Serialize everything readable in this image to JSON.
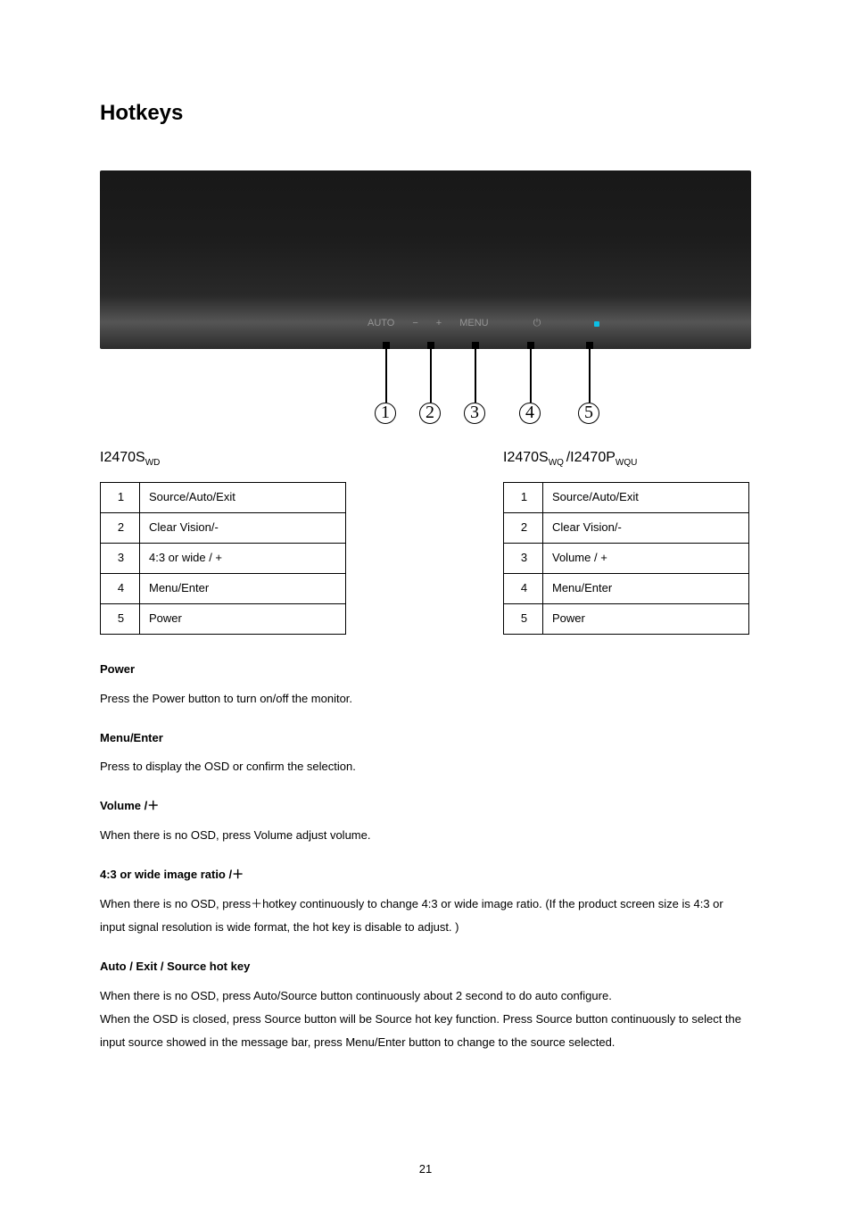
{
  "title": "Hotkeys",
  "hero": {
    "labels": {
      "auto": "AUTO",
      "minus": "−",
      "plus": "+",
      "menu": "MENU"
    },
    "power_icon": "⏻"
  },
  "pointers": [
    "1",
    "2",
    "3",
    "4",
    "5"
  ],
  "model_left": {
    "name": "I2470S",
    "suffix": "WD",
    "rows": [
      {
        "n": "1",
        "label": "Source/Auto/Exit"
      },
      {
        "n": "2",
        "label": "Clear Vision/-"
      },
      {
        "n": "3",
        "label": "4:3 or wide / +"
      },
      {
        "n": "4",
        "label": "Menu/Enter"
      },
      {
        "n": "5",
        "label": "Power"
      }
    ]
  },
  "model_right": {
    "name": "I2470S",
    "suffix": "WQ ",
    "sep": "/",
    "name2": "I2470P",
    "suffix2": "WQU",
    "rows": [
      {
        "n": "1",
        "label": "Source/Auto/Exit"
      },
      {
        "n": "2",
        "label": "Clear Vision/-"
      },
      {
        "n": "3",
        "label": "Volume / +"
      },
      {
        "n": "4",
        "label": "Menu/Enter"
      },
      {
        "n": "5",
        "label": "Power"
      }
    ]
  },
  "sections": {
    "power": {
      "title": "Power",
      "body": "Press the Power button to turn on/off the monitor."
    },
    "menu": {
      "title": "Menu/Enter",
      "body": "Press to display the OSD or confirm the selection."
    },
    "volume": {
      "title": "Volume /＋",
      "body": "When there is no OSD, press Volume adjust volume."
    },
    "ratio": {
      "title": "4:3 or wide image ratio /＋",
      "body": "When there is no OSD, press＋hotkey continuously to change 4:3 or wide image ratio. (If the product screen size is 4:3 or input signal resolution is wide format, the hot key is disable to adjust. )"
    },
    "auto": {
      "title": "Auto / Exit / Source hot key",
      "body1": "When there is no OSD, press Auto/Source button continuously about 2 second to do auto configure.",
      "body2": "When the OSD is closed, press Source button will be Source hot key function. Press Source button continuously to select the input source showed in the message bar, press Menu/Enter button to change to the source selected."
    }
  },
  "page_number": "21"
}
